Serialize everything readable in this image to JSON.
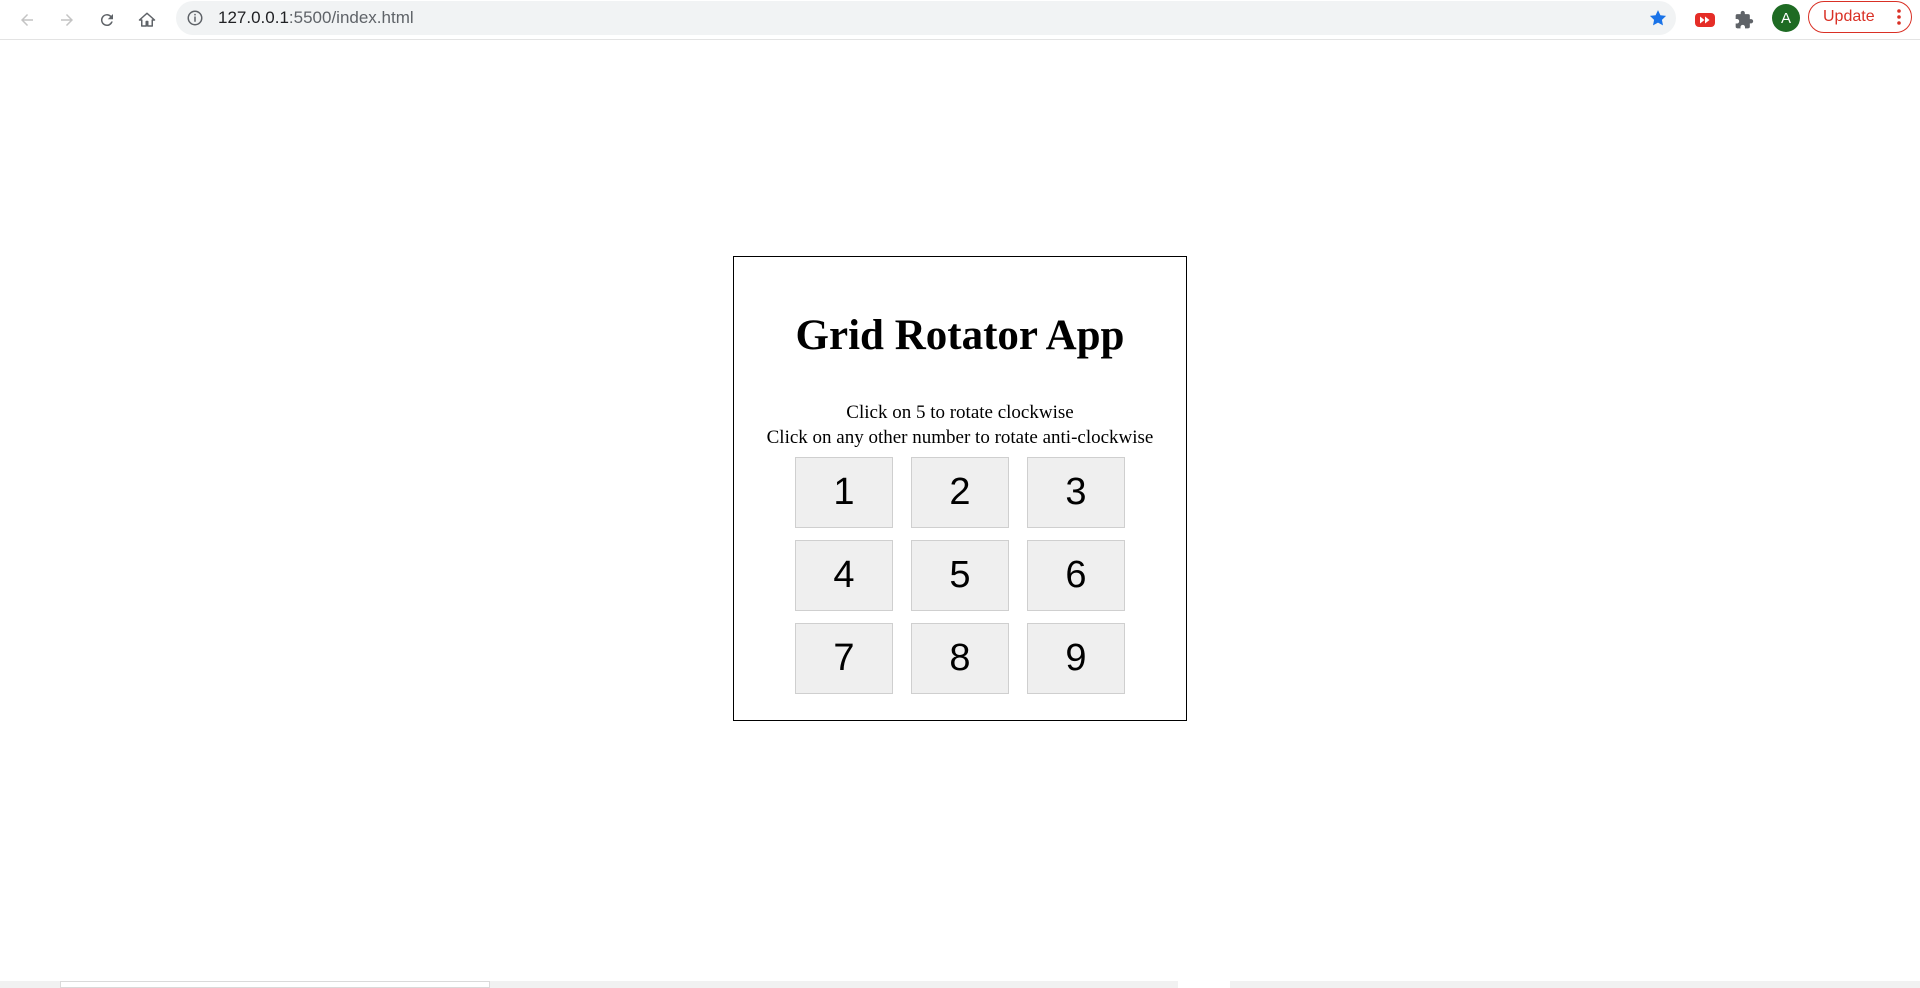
{
  "browser": {
    "url_host": "127.0.0.1",
    "url_rest": ":5500/index.html",
    "avatar_letter": "A",
    "update_label": "Update",
    "icons": {
      "back": "back-arrow-icon",
      "forward": "forward-arrow-icon",
      "reload": "reload-icon",
      "home": "home-icon",
      "info": "info-icon",
      "bookmark": "star-icon",
      "extension_1": "youtube-extension-icon",
      "extensions": "puzzle-icon",
      "menu": "kebab-menu-icon"
    },
    "colors": {
      "star": "#1a73e8",
      "update": "#d93025",
      "avatar": "#1e6b23",
      "youtube": "#e52d27"
    }
  },
  "app": {
    "title": "Grid Rotator App",
    "instruction_1": "Click on 5 to rotate clockwise",
    "instruction_2": "Click on any other number to rotate anti-clockwise",
    "cells": [
      "1",
      "2",
      "3",
      "4",
      "5",
      "6",
      "7",
      "8",
      "9"
    ]
  }
}
